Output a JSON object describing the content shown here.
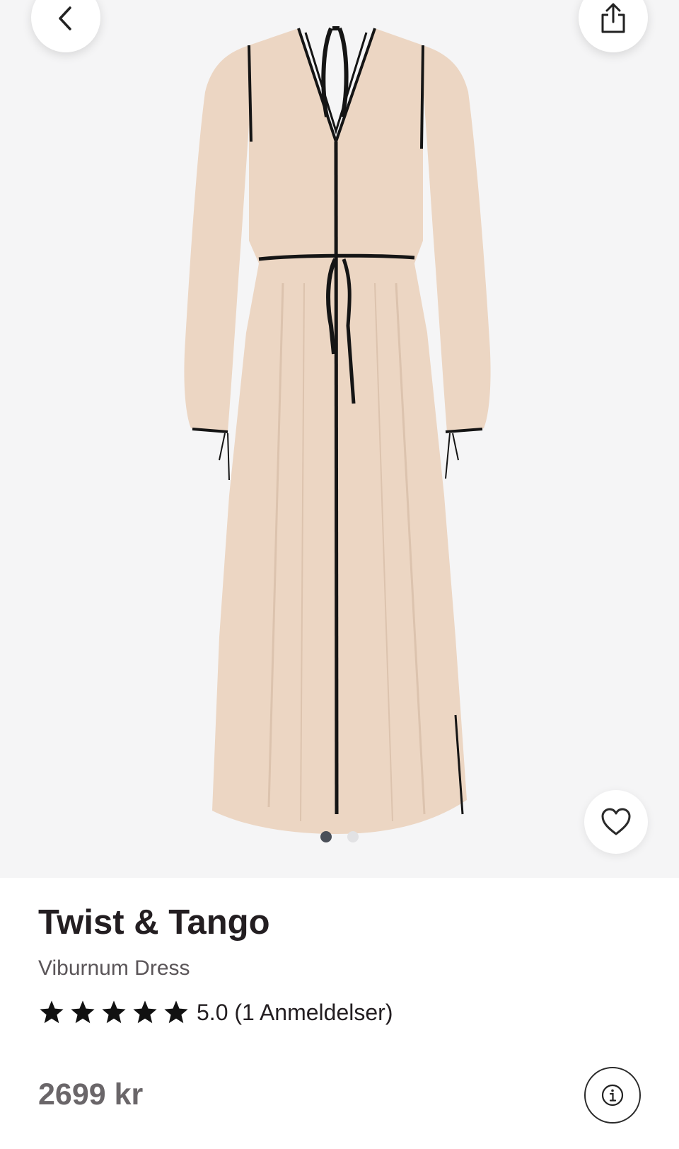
{
  "header": {
    "back_icon": "chevron-left-icon",
    "share_icon": "share-icon"
  },
  "gallery": {
    "image_alt": "Viburnum Dress",
    "image_count": 2,
    "active_index": 0,
    "favorite_icon": "heart-outline-icon"
  },
  "product": {
    "brand": "Twist & Tango",
    "name": "Viburnum Dress",
    "rating_value": 5,
    "rating_text": "5.0 (1 Anmeldelser)",
    "price": "2699 kr",
    "info_icon": "info-icon"
  },
  "colors": {
    "dress": "#ecd6c3",
    "trim": "#151515",
    "background": "#f5f5f6",
    "text_primary": "#231e21"
  }
}
